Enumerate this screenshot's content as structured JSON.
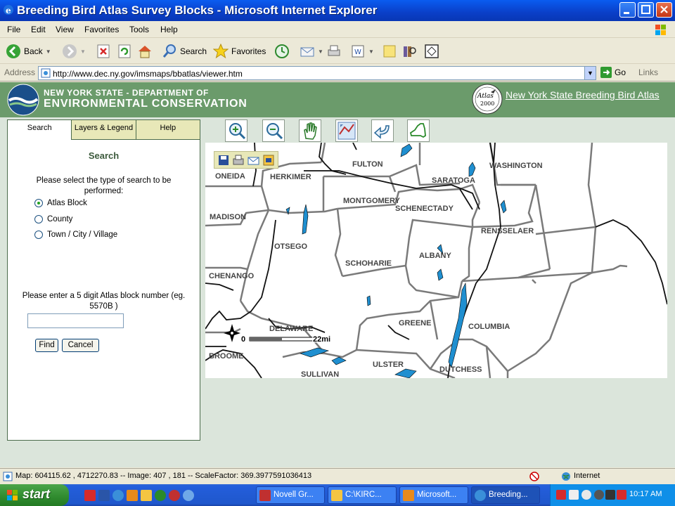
{
  "window": {
    "title": "Breeding Bird Atlas Survey Blocks - Microsoft Internet Explorer"
  },
  "menu": [
    "File",
    "Edit",
    "View",
    "Favorites",
    "Tools",
    "Help"
  ],
  "toolbar": {
    "back_label": "Back",
    "search_label": "Search",
    "favorites_label": "Favorites"
  },
  "address": {
    "label": "Address",
    "url": "http://www.dec.ny.gov/imsmaps/bbatlas/viewer.htm",
    "go_label": "Go",
    "links_label": "Links"
  },
  "header": {
    "agency_line1": "NEW YORK STATE - DEPARTMENT OF",
    "agency_line2": "ENVIRONMENTAL CONSERVATION",
    "atlas_badge_line1": "Atlas",
    "atlas_badge_line2": "2000",
    "atlas_link": "New York State Breeding Bird Atlas"
  },
  "panel": {
    "tabs": [
      "Search",
      "Layers & Legend",
      "Help"
    ],
    "title": "Search",
    "prompt": "Please select the type of search to be performed:",
    "options": [
      {
        "label": "Atlas Block",
        "checked": true
      },
      {
        "label": "County",
        "checked": false
      },
      {
        "label": "Town / City / Village",
        "checked": false
      }
    ],
    "block_prompt": "Please enter a 5 digit Atlas block number (eg. 5570B )",
    "block_value": "",
    "find_label": "Find",
    "cancel_label": "Cancel"
  },
  "map_tools": [
    "zoom-in-icon",
    "zoom-out-icon",
    "pan-hand-icon",
    "full-extent-icon",
    "back-extent-icon",
    "state-overview-icon"
  ],
  "map": {
    "counties": [
      "ONEIDA",
      "HERKIMER",
      "FULTON",
      "SARATOGA",
      "WASHINGTON",
      "MONTGOMERY",
      "SCHENECTADY",
      "MADISON",
      "OTSEGO",
      "RENSSELAER",
      "SCHOHARIE",
      "ALBANY",
      "CHENANGO",
      "DELAWARE",
      "GREENE",
      "COLUMBIA",
      "BROOME",
      "ULSTER",
      "SULLIVAN",
      "DUTCHESS"
    ],
    "scale_start": "0",
    "scale_end": "22mi"
  },
  "status": {
    "text": "Map: 604115.62 , 4712270.83 -- Image: 407 , 181 -- ScaleFactor: 369.3977591036413",
    "zone": "Internet"
  },
  "taskbar": {
    "start_label": "start",
    "tasks": [
      "Novell Gr...",
      "C:\\KIRC...",
      "Microsoft...",
      "Breeding..."
    ],
    "clock": "10:17 AM"
  }
}
